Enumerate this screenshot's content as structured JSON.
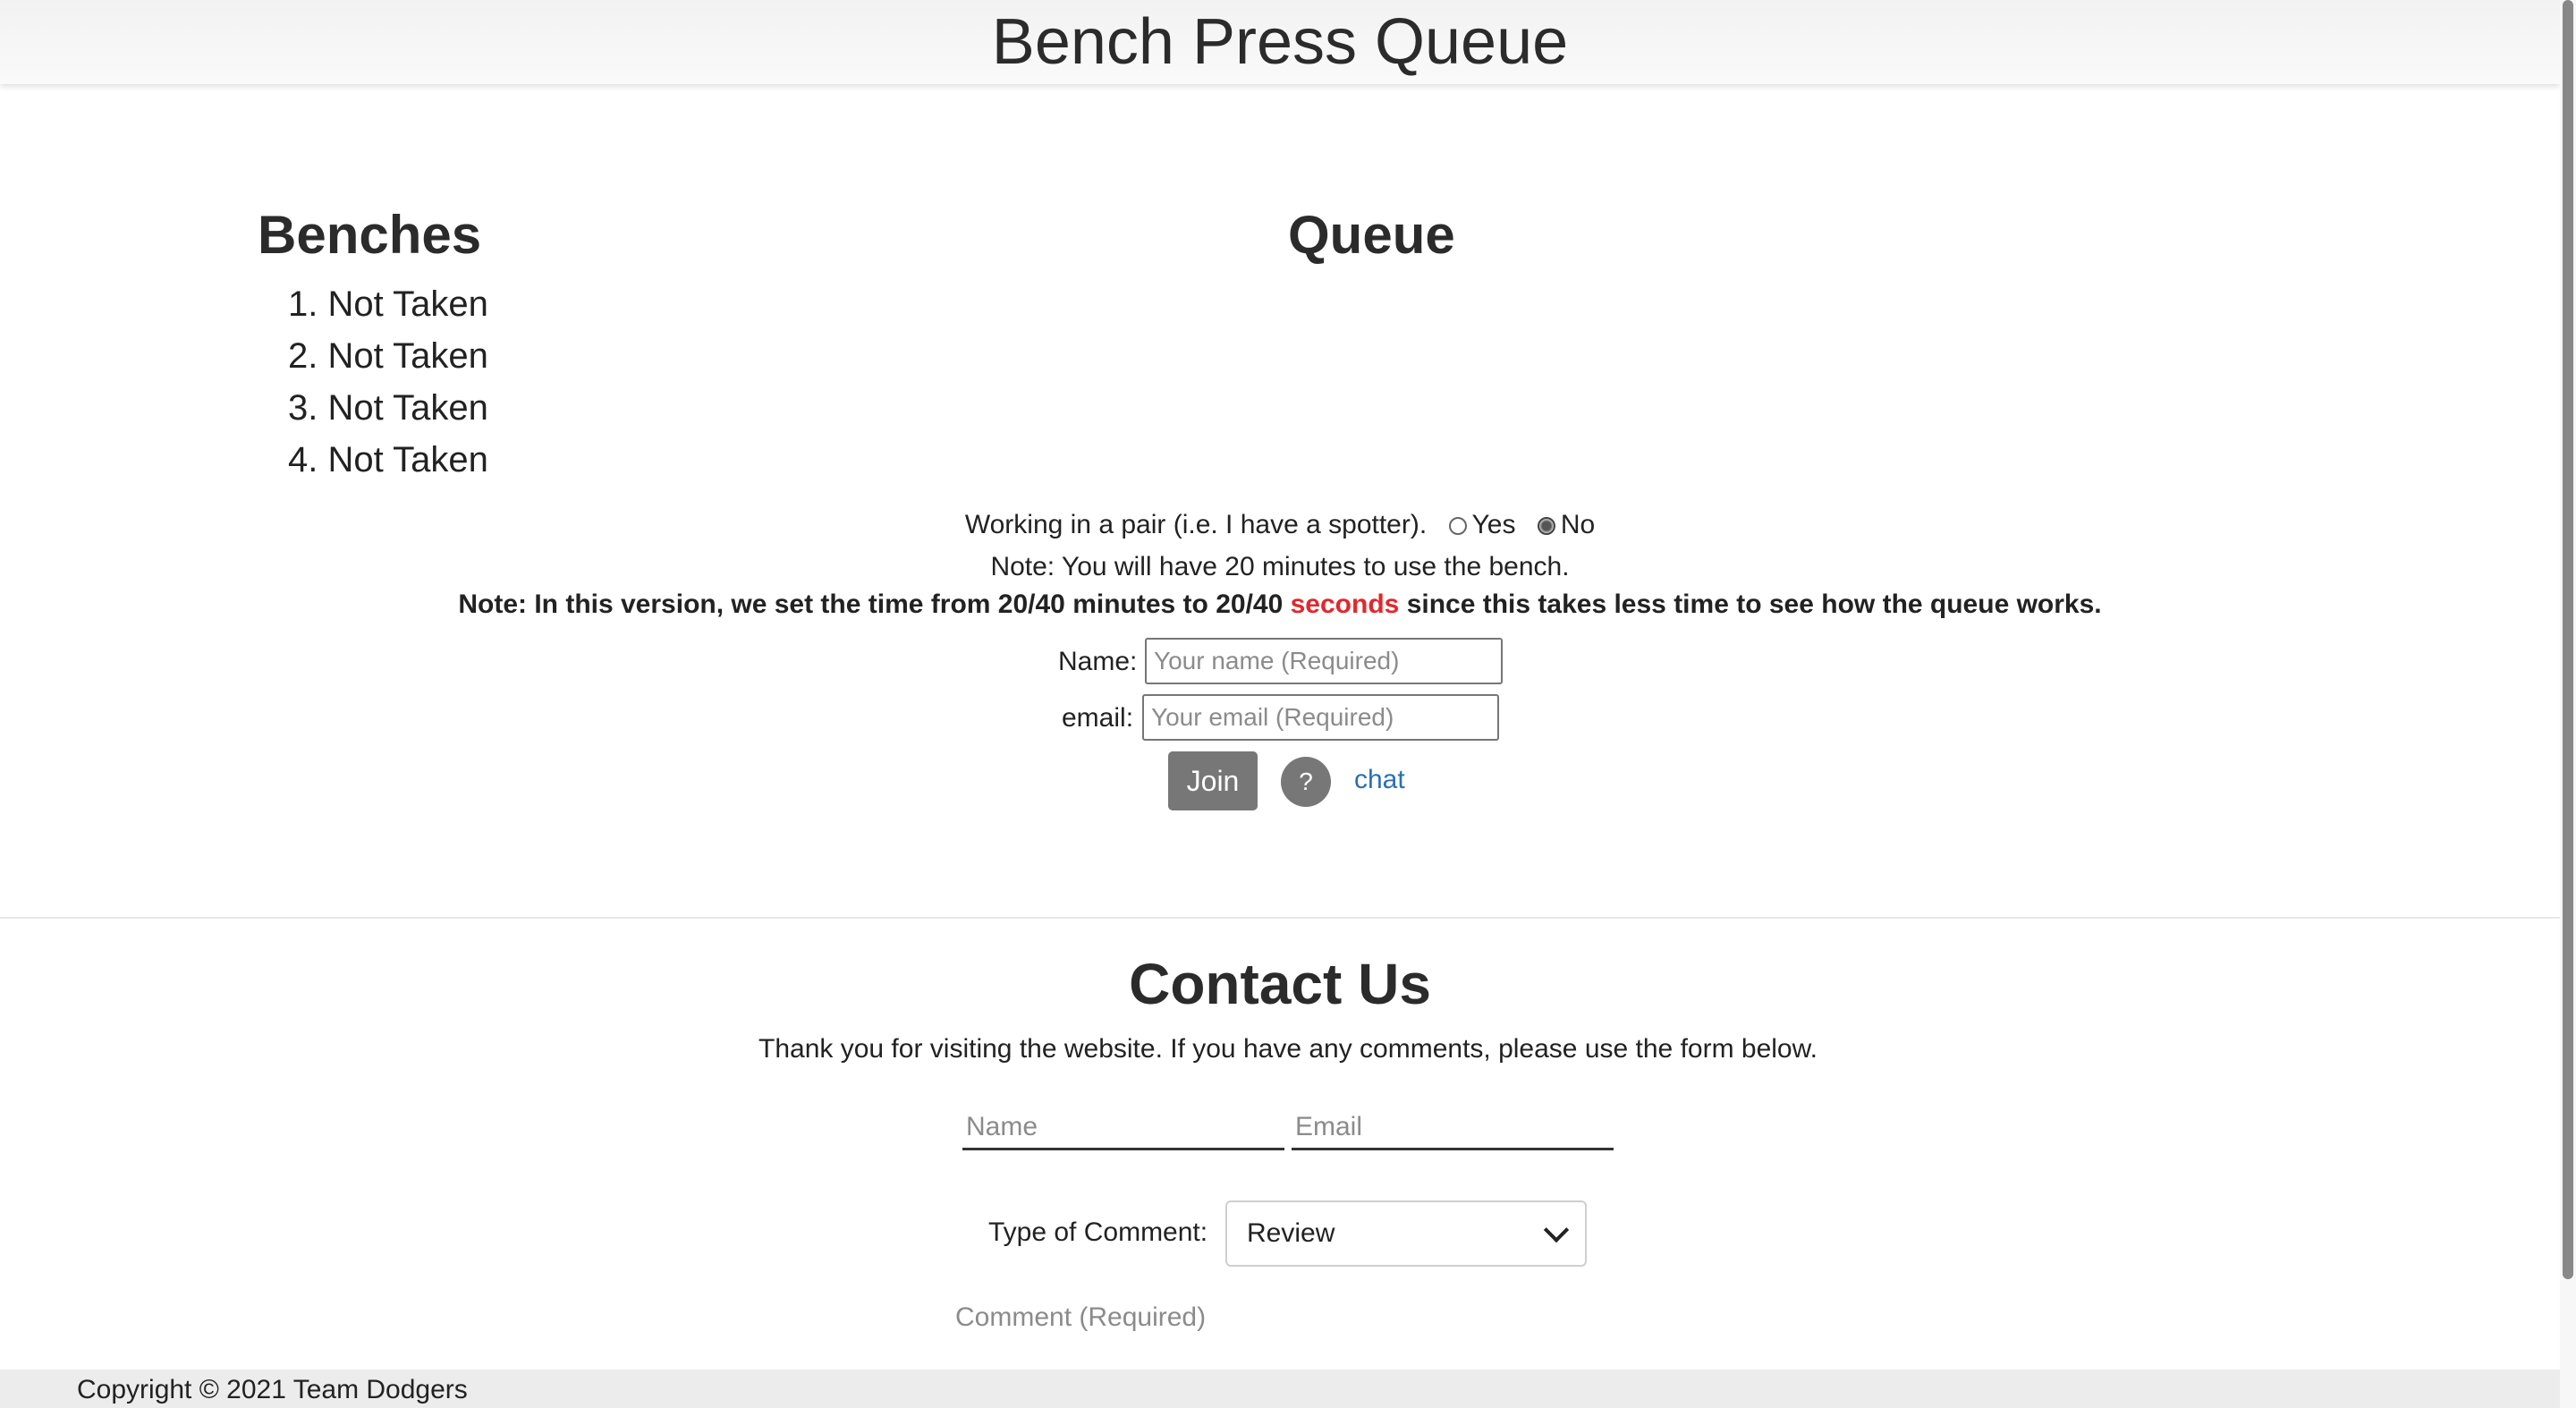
{
  "header": {
    "title": "Bench Press Queue"
  },
  "benches": {
    "title": "Benches",
    "items": [
      {
        "number": "1.",
        "status": "Not Taken"
      },
      {
        "number": "2.",
        "status": "Not Taken"
      },
      {
        "number": "3.",
        "status": "Not Taken"
      },
      {
        "number": "4.",
        "status": "Not Taken"
      }
    ]
  },
  "queue": {
    "title": "Queue"
  },
  "form": {
    "pair_prompt": "Working in a pair (i.e. I have a spotter).",
    "pair_options": [
      "Yes",
      "No"
    ],
    "pair_selected": "No",
    "note": "Note: You will have 20 minutes to use the bench.",
    "bold_note_before": "Note: In this version, we set the time from 20/40 minutes to 20/40",
    "bold_note_red": "seconds",
    "bold_note_after": "since this takes less time to see how the queue works.",
    "name_label": "Name:",
    "name_placeholder": "Your name (Required)",
    "email_label": "email:",
    "email_placeholder": "Your email (Required)",
    "join_label": "Join",
    "help_label": "?",
    "chat_label": "chat"
  },
  "contact": {
    "title": "Contact Us",
    "text": "Thank you for visiting the website. If you have any comments, please use the form below.",
    "name_placeholder": "Name",
    "email_placeholder": "Email",
    "type_label": "Type of Comment:",
    "type_selected": "Review",
    "comment_placeholder": "Comment (Required)"
  },
  "footer": {
    "copyright": "Copyright © 2021 Team Dodgers"
  },
  "colors": {
    "accent_red": "#e0282e",
    "link_blue": "#2a6fb5",
    "button_gray": "#777777"
  }
}
